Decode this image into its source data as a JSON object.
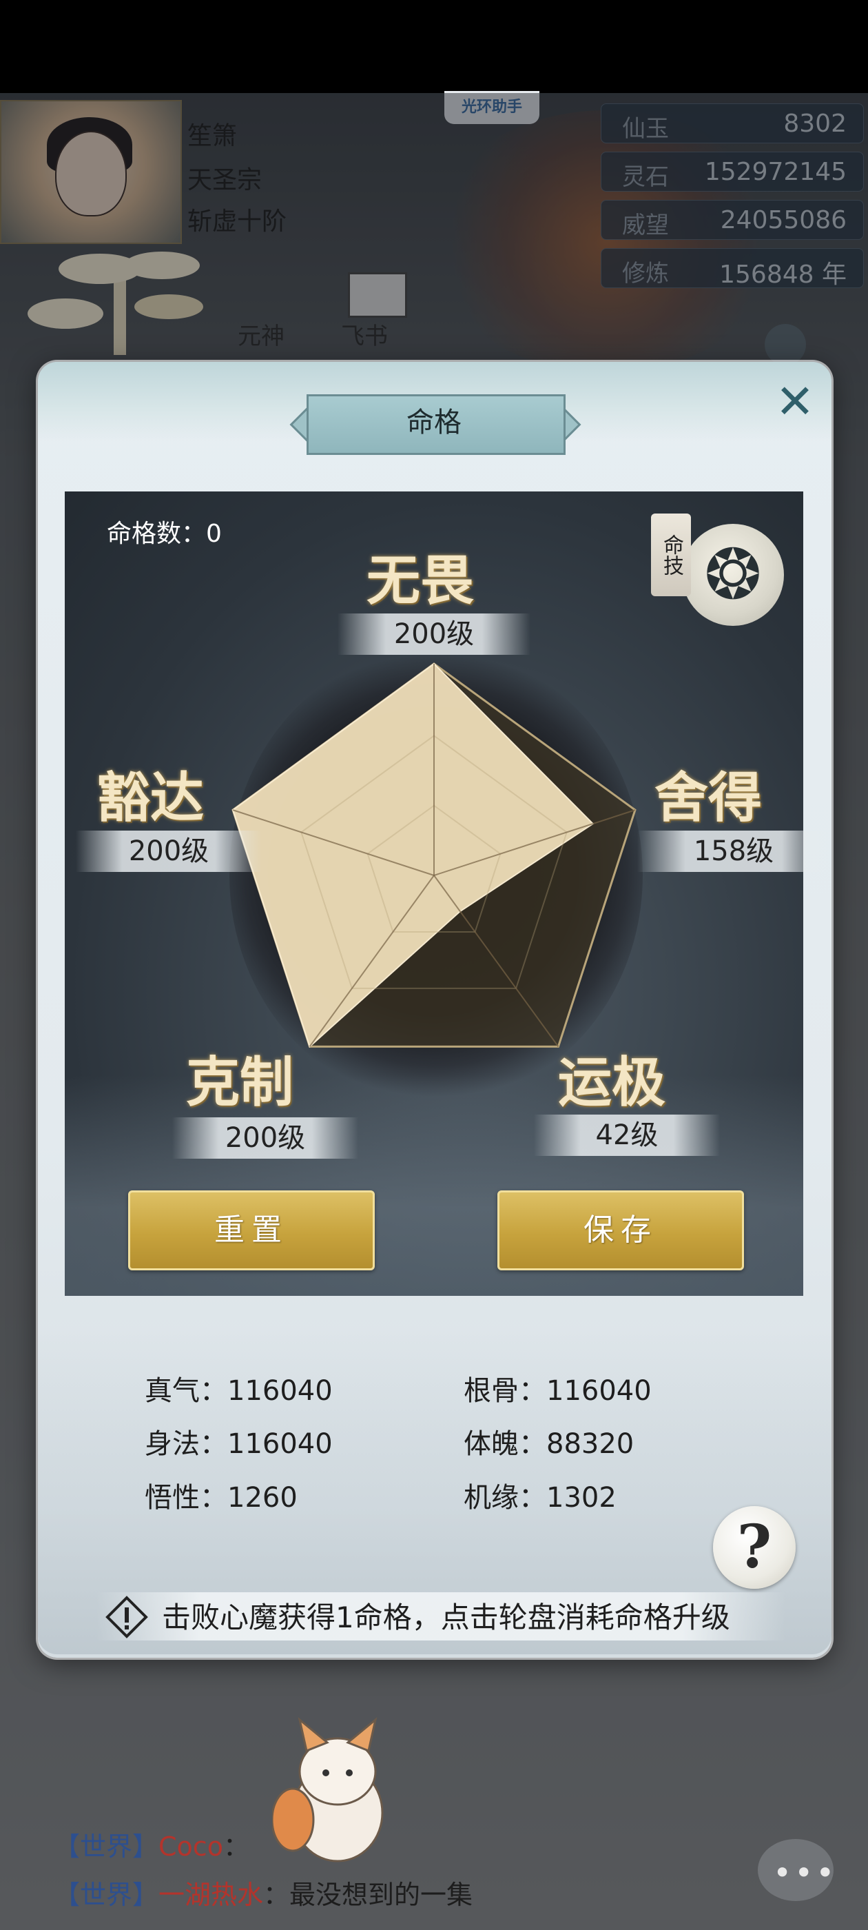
{
  "player": {
    "name": "笙箫",
    "sect": "天圣宗",
    "realm": "斩虚十阶"
  },
  "assistant_label": "光环助手",
  "resources": [
    {
      "label": "仙玉",
      "value": "8302"
    },
    {
      "label": "灵石",
      "value": "152972145"
    },
    {
      "label": "威望",
      "value": "24055086"
    },
    {
      "label": "修炼",
      "value": "156848 年"
    }
  ],
  "nav": {
    "yuanshen": "元神",
    "feishu": "飞书"
  },
  "dialog": {
    "title": "命格",
    "count_label": "命格数：0",
    "skill_tag": "命技",
    "reset_label": "重置",
    "save_label": "保存",
    "tip": "击败心魔获得1命格，点击轮盘消耗命格升级",
    "help_symbol": "?"
  },
  "attributes": [
    {
      "name": "无畏",
      "level_text": "200级",
      "level": 200
    },
    {
      "name": "舍得",
      "level_text": "158级",
      "level": 158
    },
    {
      "name": "运极",
      "level_text": "42级",
      "level": 42
    },
    {
      "name": "克制",
      "level_text": "200级",
      "level": 200
    },
    {
      "name": "豁达",
      "level_text": "200级",
      "level": 200
    }
  ],
  "radar": {
    "max_level": 200
  },
  "stats": {
    "zhenqi": "真气：116040",
    "gengu": "根骨：116040",
    "shenfa": "身法：116040",
    "tipo": "体魄：88320",
    "wuxing": "悟性：1260",
    "jiyuan": "机缘：1302"
  },
  "chat": [
    {
      "channel": "【世界】",
      "name": "Coco",
      "text": "："
    },
    {
      "channel": "【世界】",
      "name": "一湖热水",
      "text": "：最没想到的一集"
    }
  ],
  "colors": {
    "gold_button": "#c7a33d",
    "radar_fill": "#eeddb8",
    "title_plate": "#a8cbd0"
  }
}
